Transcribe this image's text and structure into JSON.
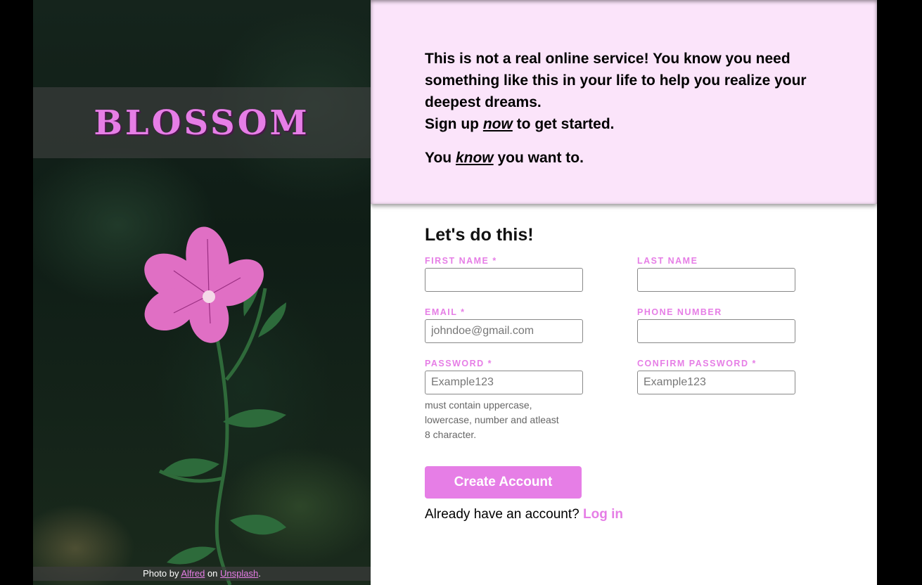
{
  "brand": {
    "name": "BLOSSOM"
  },
  "photo_credit": {
    "prefix": "Photo by",
    "author": "Alfred",
    "middle": "on",
    "site": "Unsplash",
    "suffix": "."
  },
  "intro": {
    "line1": "This is not a real online service! You know you need something like this in your life to help you realize your deepest dreams.",
    "signup_pre": "Sign up ",
    "signup_em": "now",
    "signup_post": " to get started.",
    "know_pre": "You ",
    "know_em": "know",
    "know_post": " you want to."
  },
  "form": {
    "title": "Let's do this!",
    "first_name": {
      "label": "FIRST NAME *",
      "value": "",
      "placeholder": ""
    },
    "last_name": {
      "label": "LAST NAME",
      "value": "",
      "placeholder": ""
    },
    "email": {
      "label": "EMAIL *",
      "value": "",
      "placeholder": "johndoe@gmail.com"
    },
    "phone": {
      "label": "PHONE NUMBER",
      "value": "",
      "placeholder": ""
    },
    "password": {
      "label": "PASSWORD *",
      "value": "",
      "placeholder": "Example123",
      "hint": "must contain uppercase, lowercase, number and atleast 8 character."
    },
    "confirm_password": {
      "label": "CONFIRM PASSWORD *",
      "value": "",
      "placeholder": "Example123"
    },
    "submit_label": "Create Account",
    "login_prompt": "Already have an account?",
    "login_link": "Log in"
  },
  "colors": {
    "accent": "#e67ee6",
    "intro_bg": "#fbe4fa"
  }
}
